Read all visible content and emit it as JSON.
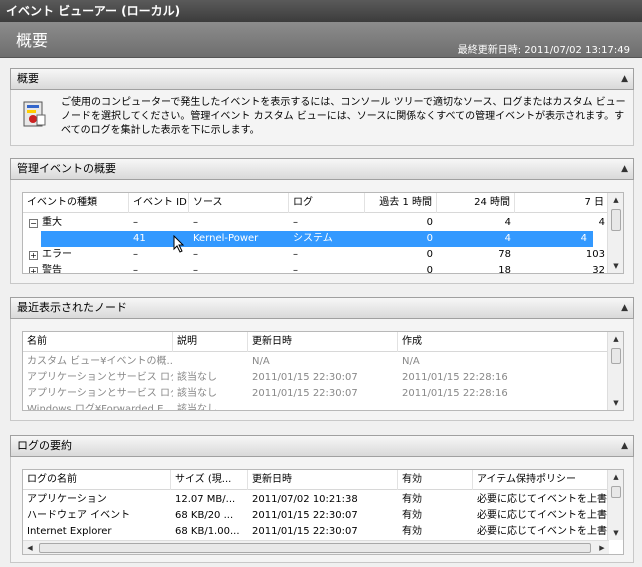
{
  "window": {
    "title": "イベント ビューアー (ローカル)"
  },
  "header": {
    "title": "概要",
    "last_updated": "最終更新日時: 2011/07/02 13:17:49"
  },
  "overview": {
    "title": "概要",
    "text": "ご使用のコンピューターで発生したイベントを表示するには、コンソール ツリーで適切なソース、ログまたはカスタム ビュー ノードを選択してください。管理イベント カスタム ビューには、ソースに関係なくすべての管理イベントが表示されます。すべてのログを集計した表示を下に示します。"
  },
  "admin_events": {
    "title": "管理イベントの概要",
    "columns": [
      "イベントの種類",
      "イベント ID",
      "ソース",
      "ログ",
      "過去 1 時間",
      "24 時間",
      "7 日"
    ],
    "rows": [
      {
        "expander": "−",
        "type": "重大",
        "id": "–",
        "source": "–",
        "log": "–",
        "hour": "0",
        "day": "4",
        "week": "4"
      },
      {
        "expander": "",
        "type": "",
        "id": "41",
        "source": "Kernel-Power",
        "log": "システム",
        "hour": "0",
        "day": "4",
        "week": "4"
      },
      {
        "expander": "+",
        "type": "エラー",
        "id": "–",
        "source": "–",
        "log": "–",
        "hour": "0",
        "day": "78",
        "week": "103"
      },
      {
        "expander": "+",
        "type": "警告",
        "id": "–",
        "source": "–",
        "log": "–",
        "hour": "0",
        "day": "18",
        "week": "32"
      }
    ]
  },
  "recent_nodes": {
    "title": "最近表示されたノード",
    "columns": [
      "名前",
      "説明",
      "更新日時",
      "作成"
    ],
    "rows": [
      {
        "name": "カスタム ビュー¥イベントの概...",
        "desc": "",
        "modified": "N/A",
        "created": "N/A"
      },
      {
        "name": "アプリケーションとサービス ログ...",
        "desc": "該当なし",
        "modified": "2011/01/15 22:30:07",
        "created": "2011/01/15 22:28:16"
      },
      {
        "name": "アプリケーションとサービス ログ...",
        "desc": "該当なし",
        "modified": "2011/01/15 22:30:07",
        "created": "2011/01/15 22:28:16"
      },
      {
        "name": "Windows ログ¥Forwarded E...",
        "desc": "該当なし",
        "modified": "",
        "created": ""
      }
    ]
  },
  "log_summary": {
    "title": "ログの要約",
    "columns": [
      "ログの名前",
      "サイズ (現...",
      "更新日時",
      "有効",
      "アイテム保持ポリシー"
    ],
    "rows": [
      {
        "name": "アプリケーション",
        "size": "12.07 MB/...",
        "modified": "2011/07/02 10:21:38",
        "enabled": "有効",
        "policy": "必要に応じてイベントを上書"
      },
      {
        "name": "ハードウェア イベント",
        "size": "68 KB/20 ...",
        "modified": "2011/01/15 22:30:07",
        "enabled": "有効",
        "policy": "必要に応じてイベントを上書"
      },
      {
        "name": "Internet Explorer",
        "size": "68 KB/1.00...",
        "modified": "2011/01/15 22:30:07",
        "enabled": "有効",
        "policy": "必要に応じてイベントを上書"
      }
    ]
  }
}
